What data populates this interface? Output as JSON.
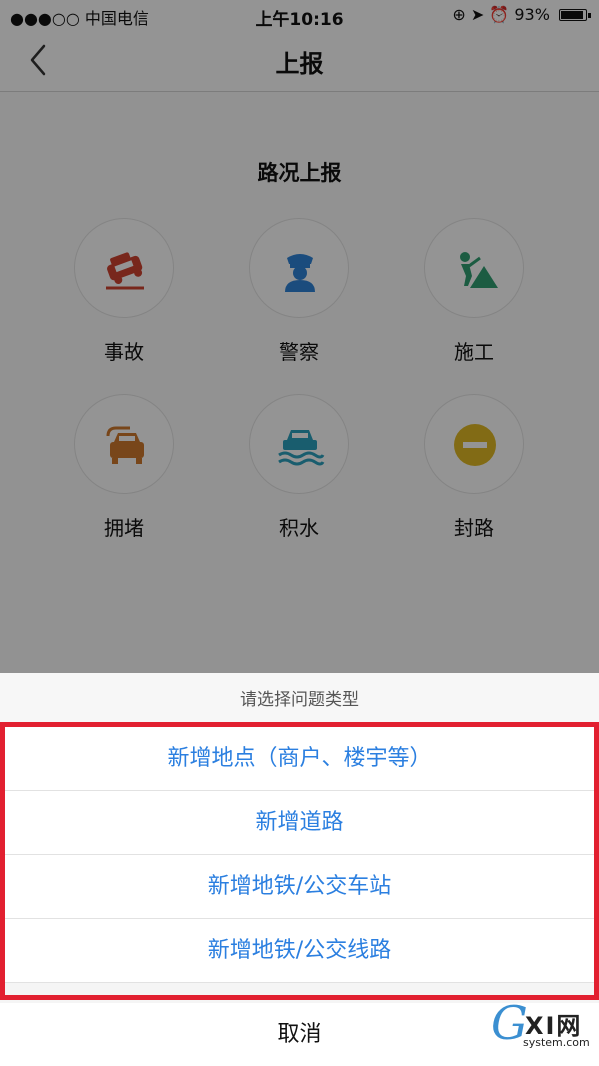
{
  "status_bar": {
    "carrier": "●●●○○ 中国电信",
    "time": "上午10:16",
    "battery": "93%"
  },
  "nav": {
    "title": "上报"
  },
  "content": {
    "section_title": "路况上报",
    "items": [
      {
        "label": "事故",
        "icon": "accident-car-icon",
        "color": "#c8412f"
      },
      {
        "label": "警察",
        "icon": "police-icon",
        "color": "#2d7fd0"
      },
      {
        "label": "施工",
        "icon": "construction-worker-icon",
        "color": "#2f9a6e"
      },
      {
        "label": "拥堵",
        "icon": "traffic-jam-icon",
        "color": "#c9762c"
      },
      {
        "label": "积水",
        "icon": "flooding-car-icon",
        "color": "#2b9bb8"
      },
      {
        "label": "封路",
        "icon": "road-closed-icon",
        "color": "#d9b323"
      }
    ]
  },
  "sheet": {
    "title": "请选择问题类型",
    "options": [
      "新增地点（商户、楼宇等）",
      "新增道路",
      "新增地铁/公交车站",
      "新增地铁/公交线路"
    ],
    "cancel": "取消",
    "highlight_color": "#e22030"
  },
  "watermark": {
    "brand": "GXI网",
    "domain": "system.com"
  }
}
